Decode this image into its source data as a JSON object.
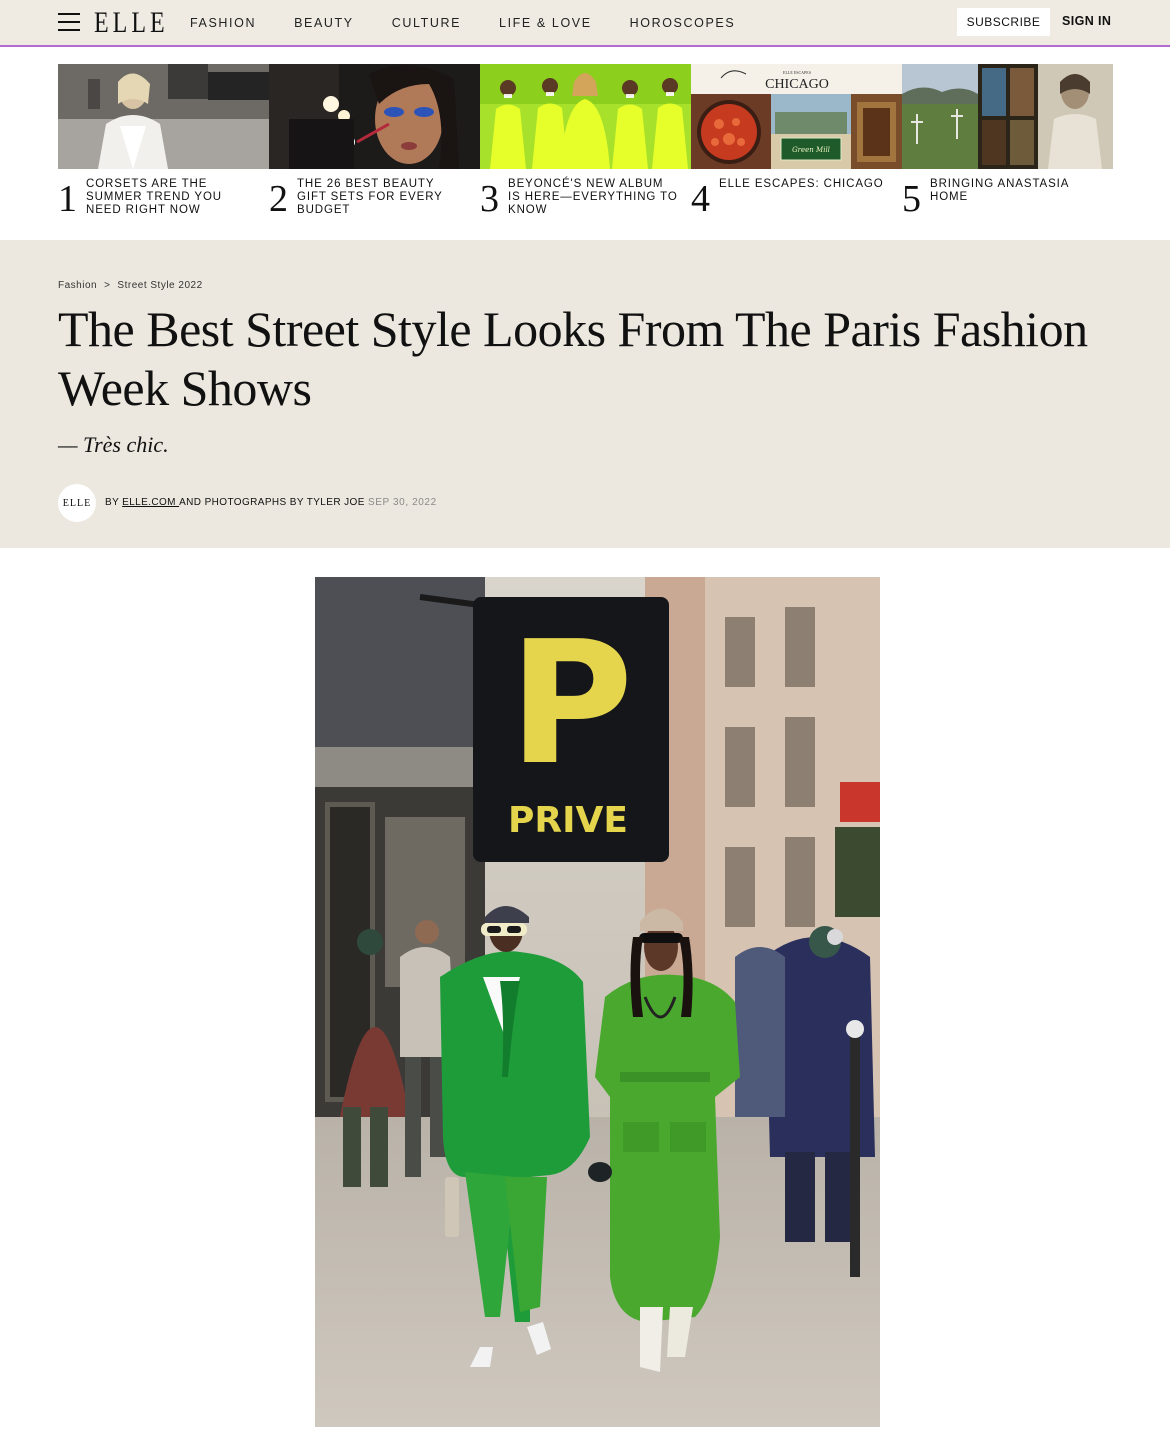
{
  "header": {
    "logo": "ELLE",
    "nav": [
      "FASHION",
      "BEAUTY",
      "CULTURE",
      "LIFE & LOVE",
      "HOROSCOPES"
    ],
    "subscribe_label": "SUBSCRIBE",
    "signin_label": "SIGN IN",
    "accent_color": "#b36bd1",
    "background_color": "#efebe3"
  },
  "trending": [
    {
      "number": "1",
      "title": "CORSETS ARE THE SUMMER TREND YOU NEED RIGHT NOW"
    },
    {
      "number": "2",
      "title": "THE 26 BEST BEAUTY GIFT SETS FOR EVERY BUDGET"
    },
    {
      "number": "3",
      "title": "BEYONCÉ'S NEW ALBUM IS HERE—EVERYTHING TO KNOW"
    },
    {
      "number": "4",
      "title": "ELLE ESCAPES: CHICAGO",
      "image_text": "CHICAGO",
      "image_subtext": "ELLE ESCAPES",
      "sign_text": "Green Mill"
    },
    {
      "number": "5",
      "title": "BRINGING ANASTASIA HOME"
    }
  ],
  "article": {
    "breadcrumb": [
      "Fashion",
      "Street Style 2022"
    ],
    "breadcrumb_separator": ">",
    "headline": "The Best Street Style Looks From The Paris Fashion Week Shows",
    "dek": "— Très chic.",
    "avatar_text": "ELLE",
    "byline_prefix": "BY ",
    "byline_link": "ELLE.COM ",
    "byline_suffix": "AND PHOTOGRAPHS BY TYLER JOE",
    "date": "SEP 30, 2022",
    "band_color": "#ece8df"
  },
  "photo": {
    "sign_letter": "P",
    "sign_text": "PRIVE"
  }
}
